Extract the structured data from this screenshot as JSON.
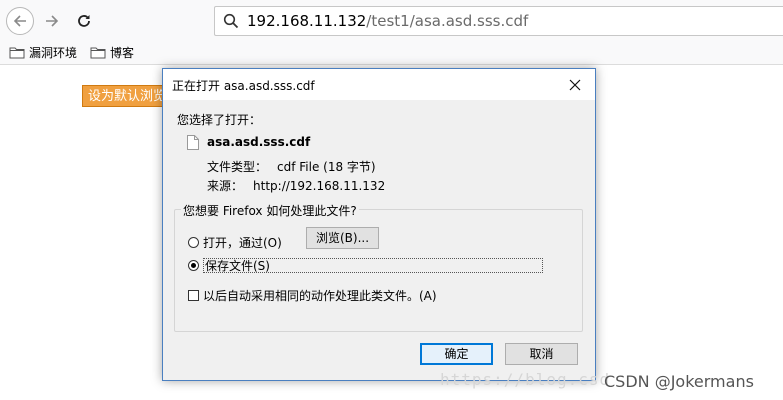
{
  "browser": {
    "url_host": "192.168.11.132",
    "url_path": "/test1/asa.asd.sss.cdf",
    "bookmarks": [
      {
        "label": "漏洞环境",
        "icon": "folder-icon"
      },
      {
        "label": "博客",
        "icon": "folder-icon"
      }
    ],
    "icons": [
      "back-icon",
      "forward-icon",
      "reload-icon",
      "search-icon"
    ]
  },
  "page": {
    "default_button_label": "设为默认浏览"
  },
  "dialog": {
    "title": "正在打开 asa.asd.sss.cdf",
    "prompt": "您选择了打开：",
    "file_name": "asa.asd.sss.cdf",
    "type_label": "文件类型：",
    "type_value": "cdf File (18 字节)",
    "source_label": "来源：",
    "source_value": "http://192.168.11.132",
    "group_legend": "您想要 Firefox 如何处理此文件?",
    "open_with_label": "打开，通过(O)",
    "browse_label": "浏览(B)...",
    "save_label": "保存文件(S)",
    "save_selected": true,
    "auto_label": "以后自动采用相同的动作处理此类文件。(A)",
    "auto_checked": false,
    "ok_label": "确定",
    "cancel_label": "取消"
  },
  "watermark": {
    "url_fragment": "https://blog.csd",
    "csdn": "CSDN @Jokermans"
  },
  "colors": {
    "accent": "#0078d7",
    "default_button_bg": "#f0a040",
    "dialog_bg": "#f0f0f0"
  }
}
